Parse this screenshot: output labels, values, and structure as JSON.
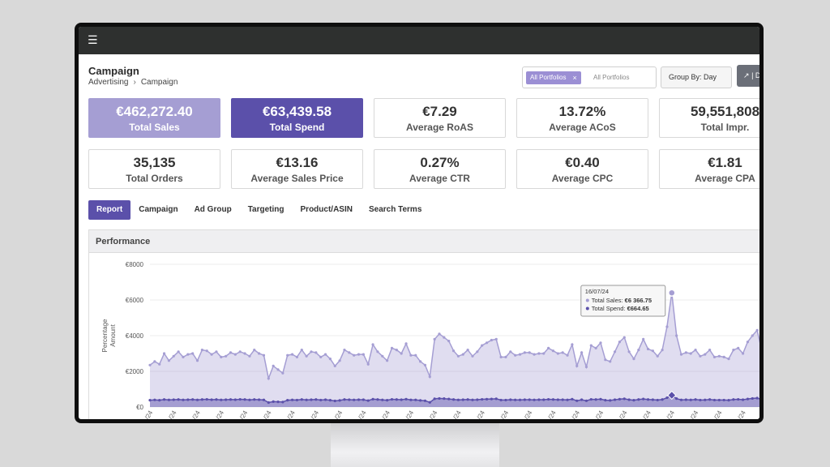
{
  "header": {
    "menu_icon": "hamburger-icon"
  },
  "page": {
    "title": "Campaign",
    "breadcrumb": [
      "Advertising",
      "Campaign"
    ]
  },
  "filters": {
    "portfolio_chip": "All Portfolios",
    "portfolio_placeholder": "All Portfolios",
    "group_by": "Group By: Day",
    "chart_toggle": "| D"
  },
  "kpis": [
    {
      "value": "€462,272.40",
      "label": "Total Sales",
      "style": "light"
    },
    {
      "value": "€63,439.58",
      "label": "Total Spend",
      "style": "dark"
    },
    {
      "value": "€7.29",
      "label": "Average RoAS",
      "style": "plain"
    },
    {
      "value": "13.72%",
      "label": "Average ACoS",
      "style": "plain"
    },
    {
      "value": "59,551,808",
      "label": "Total Impr.",
      "style": "plain"
    },
    {
      "value": "35,135",
      "label": "Total Orders",
      "style": "plain"
    },
    {
      "value": "€13.16",
      "label": "Average Sales Price",
      "style": "plain"
    },
    {
      "value": "0.27%",
      "label": "Average CTR",
      "style": "plain"
    },
    {
      "value": "€0.40",
      "label": "Average CPC",
      "style": "plain"
    },
    {
      "value": "€1.81",
      "label": "Average CPA",
      "style": "plain"
    }
  ],
  "tabs": [
    "Report",
    "Campaign",
    "Ad Group",
    "Targeting",
    "Product/ASIN",
    "Search Terms"
  ],
  "panel": {
    "title": "Performance"
  },
  "colors": {
    "sales": "#a59ed3",
    "spend": "#5b50aa",
    "accent": "#5b50aa"
  },
  "chart_data": {
    "type": "area",
    "ylabel": "Percentage Amount",
    "yticks": [
      "€0",
      "€2000",
      "€4000",
      "€6000",
      "€8000"
    ],
    "ylim": [
      0,
      8000
    ],
    "x_tick_label": "/24",
    "tooltip": {
      "date": "16/07/24",
      "lines": [
        {
          "label": "Total Sales: ",
          "value": "€6 366.75"
        },
        {
          "label": "Total Spend: ",
          "value": "€664.65"
        }
      ]
    },
    "series": [
      {
        "name": "Total Sales",
        "values": [
          2350,
          2550,
          2400,
          3000,
          2600,
          2850,
          3100,
          2800,
          2950,
          3000,
          2600,
          3200,
          3150,
          2950,
          3100,
          2800,
          2850,
          3050,
          2950,
          3100,
          3000,
          2850,
          3200,
          3000,
          2900,
          1600,
          2300,
          2100,
          1900,
          2900,
          2950,
          2800,
          3200,
          2850,
          3100,
          3050,
          2800,
          2950,
          2700,
          2300,
          2600,
          3200,
          3050,
          2900,
          2950,
          2950,
          2400,
          3500,
          3100,
          2850,
          2600,
          3300,
          3200,
          3000,
          3550,
          2900,
          2900,
          2550,
          2350,
          1700,
          3800,
          4100,
          3900,
          3700,
          3150,
          2850,
          2950,
          3200,
          2850,
          3100,
          3450,
          3600,
          3750,
          3800,
          2800,
          2800,
          3100,
          2900,
          2950,
          3050,
          3050,
          2950,
          3000,
          3000,
          3300,
          3150,
          3000,
          3050,
          2900,
          3500,
          2300,
          3050,
          2250,
          3450,
          3300,
          3600,
          2650,
          2550,
          3100,
          3650,
          3900,
          3100,
          2700,
          3200,
          3800,
          3250,
          3150,
          2850,
          3200,
          4500,
          6400,
          4000,
          2950,
          3050,
          3000,
          3200,
          2850,
          2950,
          3200,
          2800,
          2850,
          2800,
          2700,
          3200,
          3300,
          3000,
          3650,
          4000,
          4300,
          3150
        ],
        "x_highlight_index": 110
      },
      {
        "name": "Total Spend",
        "values": [
          380,
          400,
          380,
          420,
          400,
          410,
          420,
          400,
          410,
          420,
          400,
          420,
          430,
          410,
          420,
          400,
          410,
          420,
          410,
          430,
          420,
          400,
          420,
          410,
          400,
          250,
          300,
          290,
          280,
          380,
          400,
          390,
          420,
          400,
          410,
          420,
          390,
          410,
          380,
          340,
          370,
          420,
          410,
          400,
          410,
          410,
          360,
          440,
          420,
          400,
          380,
          430,
          420,
          410,
          440,
          400,
          400,
          370,
          350,
          260,
          460,
          480,
          470,
          450,
          420,
          400,
          410,
          420,
          400,
          410,
          430,
          440,
          450,
          460,
          390,
          390,
          410,
          400,
          400,
          410,
          410,
          400,
          410,
          410,
          430,
          420,
          410,
          410,
          400,
          440,
          350,
          410,
          350,
          430,
          420,
          440,
          380,
          370,
          410,
          440,
          460,
          410,
          380,
          420,
          450,
          420,
          410,
          390,
          420,
          520,
          660,
          470,
          400,
          410,
          400,
          420,
          390,
          400,
          420,
          390,
          390,
          390,
          380,
          420,
          430,
          410,
          450,
          480,
          500,
          420
        ],
        "x_highlight_index": 110
      }
    ]
  }
}
